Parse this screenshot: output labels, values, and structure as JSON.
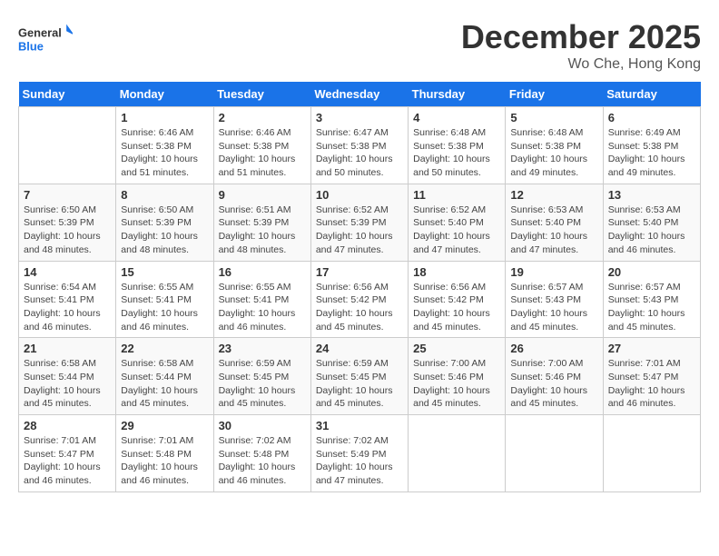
{
  "header": {
    "logo_line1": "General",
    "logo_line2": "Blue",
    "month": "December 2025",
    "location": "Wo Che, Hong Kong"
  },
  "weekdays": [
    "Sunday",
    "Monday",
    "Tuesday",
    "Wednesday",
    "Thursday",
    "Friday",
    "Saturday"
  ],
  "weeks": [
    [
      {
        "day": "",
        "text": ""
      },
      {
        "day": "1",
        "text": "Sunrise: 6:46 AM\nSunset: 5:38 PM\nDaylight: 10 hours\nand 51 minutes."
      },
      {
        "day": "2",
        "text": "Sunrise: 6:46 AM\nSunset: 5:38 PM\nDaylight: 10 hours\nand 51 minutes."
      },
      {
        "day": "3",
        "text": "Sunrise: 6:47 AM\nSunset: 5:38 PM\nDaylight: 10 hours\nand 50 minutes."
      },
      {
        "day": "4",
        "text": "Sunrise: 6:48 AM\nSunset: 5:38 PM\nDaylight: 10 hours\nand 50 minutes."
      },
      {
        "day": "5",
        "text": "Sunrise: 6:48 AM\nSunset: 5:38 PM\nDaylight: 10 hours\nand 49 minutes."
      },
      {
        "day": "6",
        "text": "Sunrise: 6:49 AM\nSunset: 5:38 PM\nDaylight: 10 hours\nand 49 minutes."
      }
    ],
    [
      {
        "day": "7",
        "text": "Sunrise: 6:50 AM\nSunset: 5:39 PM\nDaylight: 10 hours\nand 48 minutes."
      },
      {
        "day": "8",
        "text": "Sunrise: 6:50 AM\nSunset: 5:39 PM\nDaylight: 10 hours\nand 48 minutes."
      },
      {
        "day": "9",
        "text": "Sunrise: 6:51 AM\nSunset: 5:39 PM\nDaylight: 10 hours\nand 48 minutes."
      },
      {
        "day": "10",
        "text": "Sunrise: 6:52 AM\nSunset: 5:39 PM\nDaylight: 10 hours\nand 47 minutes."
      },
      {
        "day": "11",
        "text": "Sunrise: 6:52 AM\nSunset: 5:40 PM\nDaylight: 10 hours\nand 47 minutes."
      },
      {
        "day": "12",
        "text": "Sunrise: 6:53 AM\nSunset: 5:40 PM\nDaylight: 10 hours\nand 47 minutes."
      },
      {
        "day": "13",
        "text": "Sunrise: 6:53 AM\nSunset: 5:40 PM\nDaylight: 10 hours\nand 46 minutes."
      }
    ],
    [
      {
        "day": "14",
        "text": "Sunrise: 6:54 AM\nSunset: 5:41 PM\nDaylight: 10 hours\nand 46 minutes."
      },
      {
        "day": "15",
        "text": "Sunrise: 6:55 AM\nSunset: 5:41 PM\nDaylight: 10 hours\nand 46 minutes."
      },
      {
        "day": "16",
        "text": "Sunrise: 6:55 AM\nSunset: 5:41 PM\nDaylight: 10 hours\nand 46 minutes."
      },
      {
        "day": "17",
        "text": "Sunrise: 6:56 AM\nSunset: 5:42 PM\nDaylight: 10 hours\nand 45 minutes."
      },
      {
        "day": "18",
        "text": "Sunrise: 6:56 AM\nSunset: 5:42 PM\nDaylight: 10 hours\nand 45 minutes."
      },
      {
        "day": "19",
        "text": "Sunrise: 6:57 AM\nSunset: 5:43 PM\nDaylight: 10 hours\nand 45 minutes."
      },
      {
        "day": "20",
        "text": "Sunrise: 6:57 AM\nSunset: 5:43 PM\nDaylight: 10 hours\nand 45 minutes."
      }
    ],
    [
      {
        "day": "21",
        "text": "Sunrise: 6:58 AM\nSunset: 5:44 PM\nDaylight: 10 hours\nand 45 minutes."
      },
      {
        "day": "22",
        "text": "Sunrise: 6:58 AM\nSunset: 5:44 PM\nDaylight: 10 hours\nand 45 minutes."
      },
      {
        "day": "23",
        "text": "Sunrise: 6:59 AM\nSunset: 5:45 PM\nDaylight: 10 hours\nand 45 minutes."
      },
      {
        "day": "24",
        "text": "Sunrise: 6:59 AM\nSunset: 5:45 PM\nDaylight: 10 hours\nand 45 minutes."
      },
      {
        "day": "25",
        "text": "Sunrise: 7:00 AM\nSunset: 5:46 PM\nDaylight: 10 hours\nand 45 minutes."
      },
      {
        "day": "26",
        "text": "Sunrise: 7:00 AM\nSunset: 5:46 PM\nDaylight: 10 hours\nand 45 minutes."
      },
      {
        "day": "27",
        "text": "Sunrise: 7:01 AM\nSunset: 5:47 PM\nDaylight: 10 hours\nand 46 minutes."
      }
    ],
    [
      {
        "day": "28",
        "text": "Sunrise: 7:01 AM\nSunset: 5:47 PM\nDaylight: 10 hours\nand 46 minutes."
      },
      {
        "day": "29",
        "text": "Sunrise: 7:01 AM\nSunset: 5:48 PM\nDaylight: 10 hours\nand 46 minutes."
      },
      {
        "day": "30",
        "text": "Sunrise: 7:02 AM\nSunset: 5:48 PM\nDaylight: 10 hours\nand 46 minutes."
      },
      {
        "day": "31",
        "text": "Sunrise: 7:02 AM\nSunset: 5:49 PM\nDaylight: 10 hours\nand 47 minutes."
      },
      {
        "day": "",
        "text": ""
      },
      {
        "day": "",
        "text": ""
      },
      {
        "day": "",
        "text": ""
      }
    ]
  ]
}
